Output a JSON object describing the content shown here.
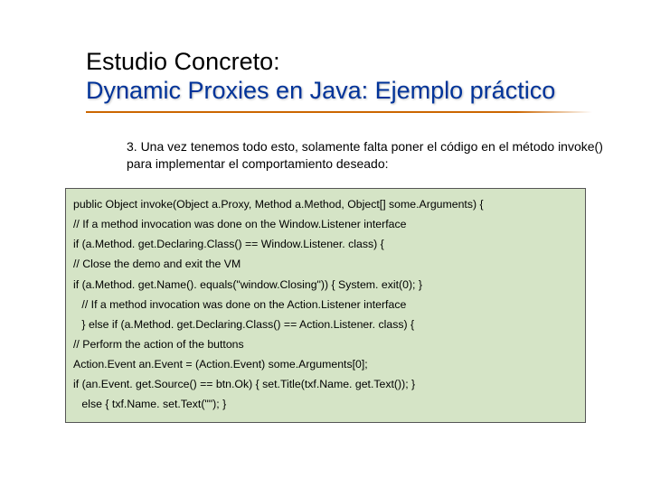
{
  "title": {
    "line1": "Estudio Concreto:",
    "line2": "Dynamic Proxies en Java: Ejemplo práctico"
  },
  "body": {
    "text": "3. Una vez tenemos todo esto, solamente falta poner el código en el método invoke() para implementar el comportamiento deseado:"
  },
  "code": {
    "lines": [
      "public Object invoke(Object a.Proxy, Method a.Method, Object[] some.Arguments) {",
      "// If a method invocation was done on the Window.Listener interface",
      "if (a.Method. get.Declaring.Class() == Window.Listener. class) {",
      "// Close the demo and exit the VM",
      "if (a.Method. get.Name(). equals(\"window.Closing\")) { System. exit(0); }",
      " // If a method invocation was done on the Action.Listener interface",
      " } else if (a.Method. get.Declaring.Class() == Action.Listener. class) {",
      "// Perform the action of the buttons",
      "Action.Event an.Event = (Action.Event) some.Arguments[0];",
      "if (an.Event. get.Source() == btn.Ok) { set.Title(txf.Name. get.Text()); }",
      " else { txf.Name. set.Text(\"\"); }"
    ]
  }
}
